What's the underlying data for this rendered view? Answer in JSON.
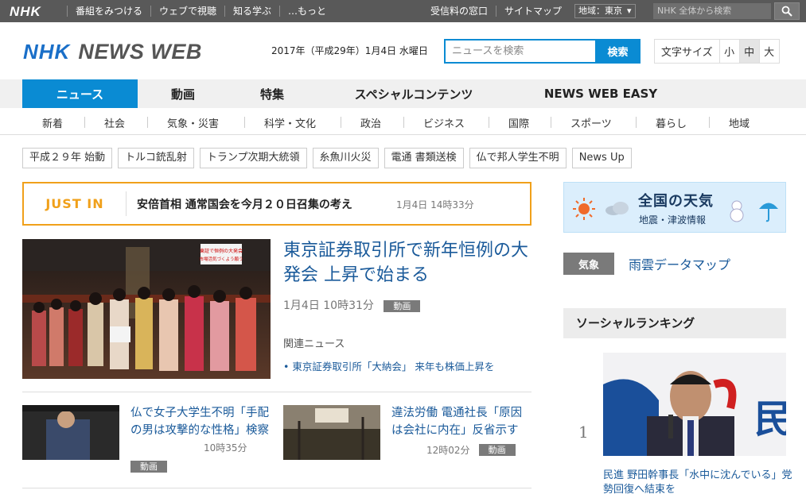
{
  "global_bar": {
    "logo": "NHK",
    "nav": [
      "番組をみつける",
      "ウェブで視聴",
      "知る学ぶ",
      "…もっと"
    ],
    "right_nav": [
      "受信料の窓口",
      "サイトマップ"
    ],
    "region_label": "地域：東京",
    "search_placeholder": "NHK 全体から検索"
  },
  "header": {
    "logo_nhk": "NHK",
    "logo_newsweb": "NEWS WEB",
    "date": "2017年（平成29年）1月4日 水曜日",
    "search_placeholder": "ニュースを検索",
    "search_button": "検索",
    "font_size_label": "文字サイズ",
    "font_sizes": [
      "小",
      "中",
      "大"
    ]
  },
  "main_nav": [
    "ニュース",
    "動画",
    "特集",
    "スペシャルコンテンツ",
    "NEWS WEB EASY"
  ],
  "sub_nav": [
    "新着",
    "社会",
    "気象・災害",
    "科学・文化",
    "政治",
    "ビジネス",
    "国際",
    "スポーツ",
    "暮らし",
    "地域"
  ],
  "tags": [
    "平成２９年 始動",
    "トルコ銃乱射",
    "トランプ次期大統領",
    "糸魚川火災",
    "電通 書類送検",
    "仏で邦人学生不明",
    "News Up"
  ],
  "just_in": {
    "label": "JUST IN",
    "title": "安倍首相 通常国会を今月２０日召集の考え",
    "time": "1月4日 14時33分"
  },
  "top_story": {
    "title": "東京証券取引所で新年恒例の大発会 上昇で始まる",
    "time": "1月4日 10時31分",
    "badge": "動画",
    "related_head": "関連ニュース",
    "related_item": "• 東京証券取引所「大納会」 来年も株価上昇を",
    "sign_text_1": "東証で恒例の大発会",
    "sign_text_2": "市場活気づくよう願う"
  },
  "stories": [
    {
      "title": "仏で女子大学生不明「手配の男は攻撃的な性格」検察",
      "time": "10時35分",
      "badge": "動画"
    },
    {
      "title": "違法労働 電通社長「原因は会社に内在」反省示す",
      "time": "12時02分",
      "badge": "動画"
    }
  ],
  "weather": {
    "title": "全国の天気",
    "subtitle": "地震・津波情報"
  },
  "kisho": {
    "badge": "気象",
    "link": "雨雲データマップ"
  },
  "social": {
    "heading": "ソーシャルランキング",
    "rank": "1",
    "title": "民進 野田幹事長「水中に沈んでいる」党勢回復へ結束を",
    "image_text": "民"
  },
  "colors": {
    "accent": "#0a8bd3",
    "justin": "#f0a01a",
    "link": "#1a5a9a",
    "topbar": "#595959"
  }
}
